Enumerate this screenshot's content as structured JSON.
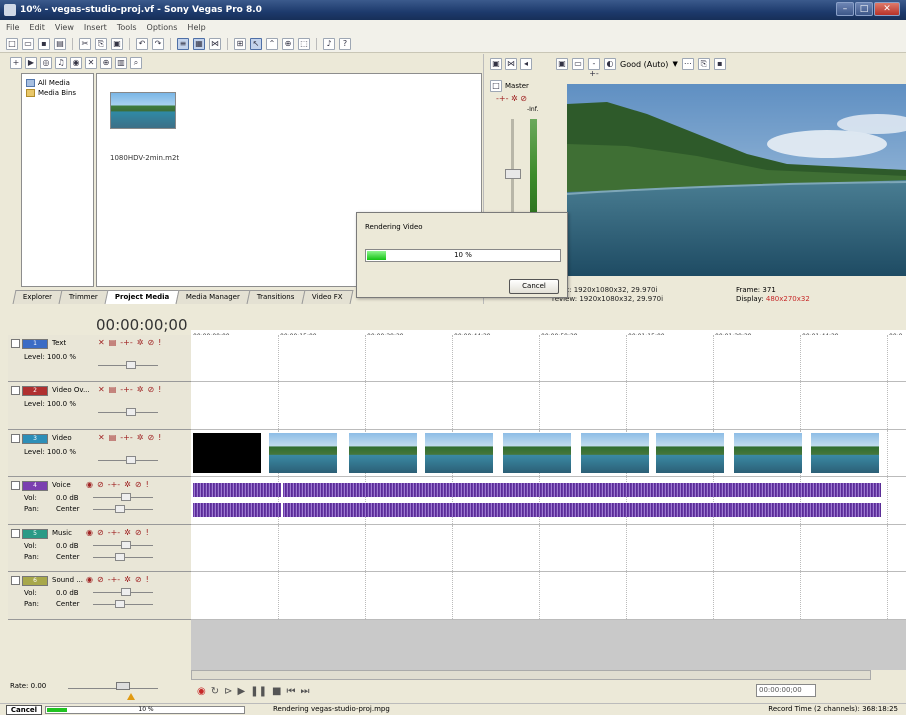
{
  "window": {
    "title": "10% - vegas-studio-proj.vf - Sony Vegas Pro 8.0",
    "min": "–",
    "max": "□",
    "close": "✕"
  },
  "menu": [
    "File",
    "Edit",
    "View",
    "Insert",
    "Tools",
    "Options",
    "Help"
  ],
  "explorer": {
    "tree": [
      {
        "label": "All Media",
        "icon": "folder-icon"
      },
      {
        "label": "Media Bins",
        "icon": "folder-icon"
      }
    ],
    "media": {
      "filename": "1080HDV-2min.m2t"
    },
    "tabs": [
      "Explorer",
      "Trimmer",
      "Project Media",
      "Media Manager",
      "Transitions",
      "Video FX"
    ],
    "active_tab": "Project Media"
  },
  "mixer": {
    "label": "Master",
    "peak": "-Inf."
  },
  "preview": {
    "quality": "Good (Auto)",
    "project_line": "oject:  1920x1080x32, 29.970i",
    "preview_line": "review:  1920x1080x32, 29.970i",
    "frame_label": "Frame:",
    "frame_value": "371",
    "display_label": "Display:",
    "display_value": "480x270x32",
    "display_color": "#c62828"
  },
  "render_dialog": {
    "title": "Rendering Video",
    "progress_pct": 10,
    "progress_text": "10 %",
    "cancel_label": "Cancel"
  },
  "timeline": {
    "timecode": "00:00:00;00",
    "ruler_ticks": [
      "00:00:00;00",
      "00:00:15;00",
      "00:00:29;29",
      "00:00:44;29",
      "00:00:59;28",
      "00:01:15;00",
      "00:01:29;29",
      "00:01:44;29",
      "00:0"
    ],
    "tracks": [
      {
        "num": "1",
        "name": "Text",
        "type": "video",
        "color": "#3b6cc5",
        "line1": "Level: 100.0 %"
      },
      {
        "num": "2",
        "name": "Video Ov...",
        "type": "video",
        "color": "#b03030",
        "line1": "Level: 100.0 %"
      },
      {
        "num": "3",
        "name": "Video",
        "type": "video",
        "color": "#2d8fb8",
        "line1": "Level: 100.0 %"
      },
      {
        "num": "4",
        "name": "Voice",
        "type": "audio",
        "color": "#7b3fb0",
        "vol": "0.0 dB",
        "pan": "Center"
      },
      {
        "num": "5",
        "name": "Music",
        "type": "audio",
        "color": "#2a9a86",
        "vol": "0.0 dB",
        "pan": "Center"
      },
      {
        "num": "6",
        "name": "Sound ...",
        "type": "audio",
        "color": "#a8a84a",
        "vol": "0.0 dB",
        "pan": "Center"
      }
    ],
    "vol_label": "Vol:",
    "pan_label": "Pan:",
    "rate": "Rate: 0.00",
    "transport_time": "00:00:00;00"
  },
  "status": {
    "cancel": "Cancel",
    "progress_pct": 10,
    "progress_text": "10 %",
    "message": "Rendering vegas-studio-proj.mpg",
    "record_time": "Record Time (2 channels): 368:18:25"
  },
  "colors": {
    "accent": "#1d3a6c",
    "progress": "#13c313",
    "audio_wave": "#6a3ba8"
  }
}
